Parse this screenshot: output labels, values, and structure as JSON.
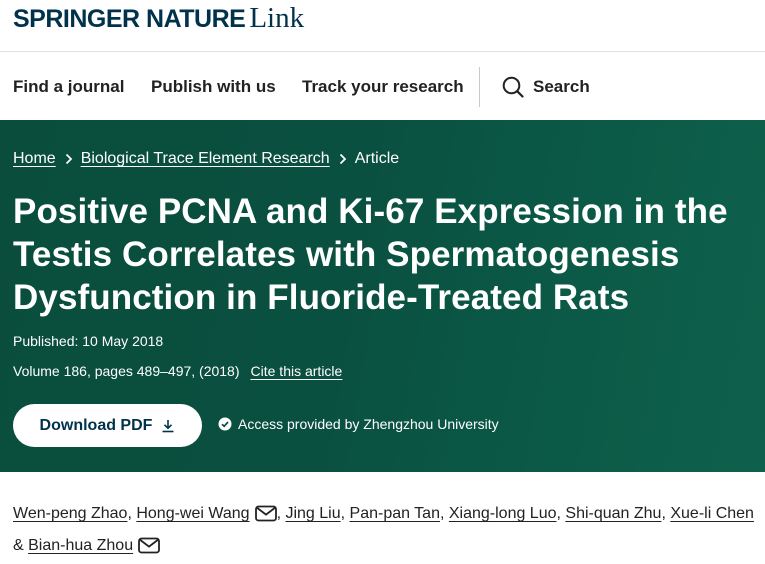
{
  "brand": {
    "name_primary": "SPRINGER NATURE",
    "name_secondary": "Link"
  },
  "nav": {
    "items": [
      {
        "label": "Find a journal"
      },
      {
        "label": "Publish with us"
      },
      {
        "label": "Track your research"
      }
    ],
    "search_label": "Search",
    "search_icon": "search-icon"
  },
  "breadcrumb": {
    "items": [
      {
        "label": "Home"
      },
      {
        "label": "Biological Trace Element Research"
      }
    ],
    "current": "Article"
  },
  "article": {
    "title": "Positive PCNA and Ki-67 Expression in the Testis Correlates with Spermatogenesis Dysfunction in Fluoride-Treated Rats",
    "published": "Published: 10 May 2018",
    "volume_line": "Volume 186, pages 489–497, (2018)",
    "cite_label": "Cite this article",
    "download_label": "Download PDF",
    "download_icon": "download-icon",
    "access_text": "Access provided by Zhengzhou University",
    "access_icon": "check-circle-icon"
  },
  "authors": [
    {
      "name": "Wen-peng Zhao",
      "sep": ", "
    },
    {
      "name": "Hong-wei Wang",
      "sep": ", "
    },
    {
      "name": "Jing Liu",
      "sep": ", "
    },
    {
      "name": "Pan-pan Tan",
      "sep": ", "
    },
    {
      "name": "Xiang-long Luo",
      "sep": ", "
    },
    {
      "name": "Shi-quan Zhu",
      "sep": ", "
    },
    {
      "name": "Xue-li Chen",
      "sep": " & "
    },
    {
      "name": "Bian-hua Zhou",
      "sep": ""
    }
  ],
  "colors": {
    "brand_navy": "#01324b",
    "hero_green": "#0a5040",
    "text": "#222222"
  }
}
